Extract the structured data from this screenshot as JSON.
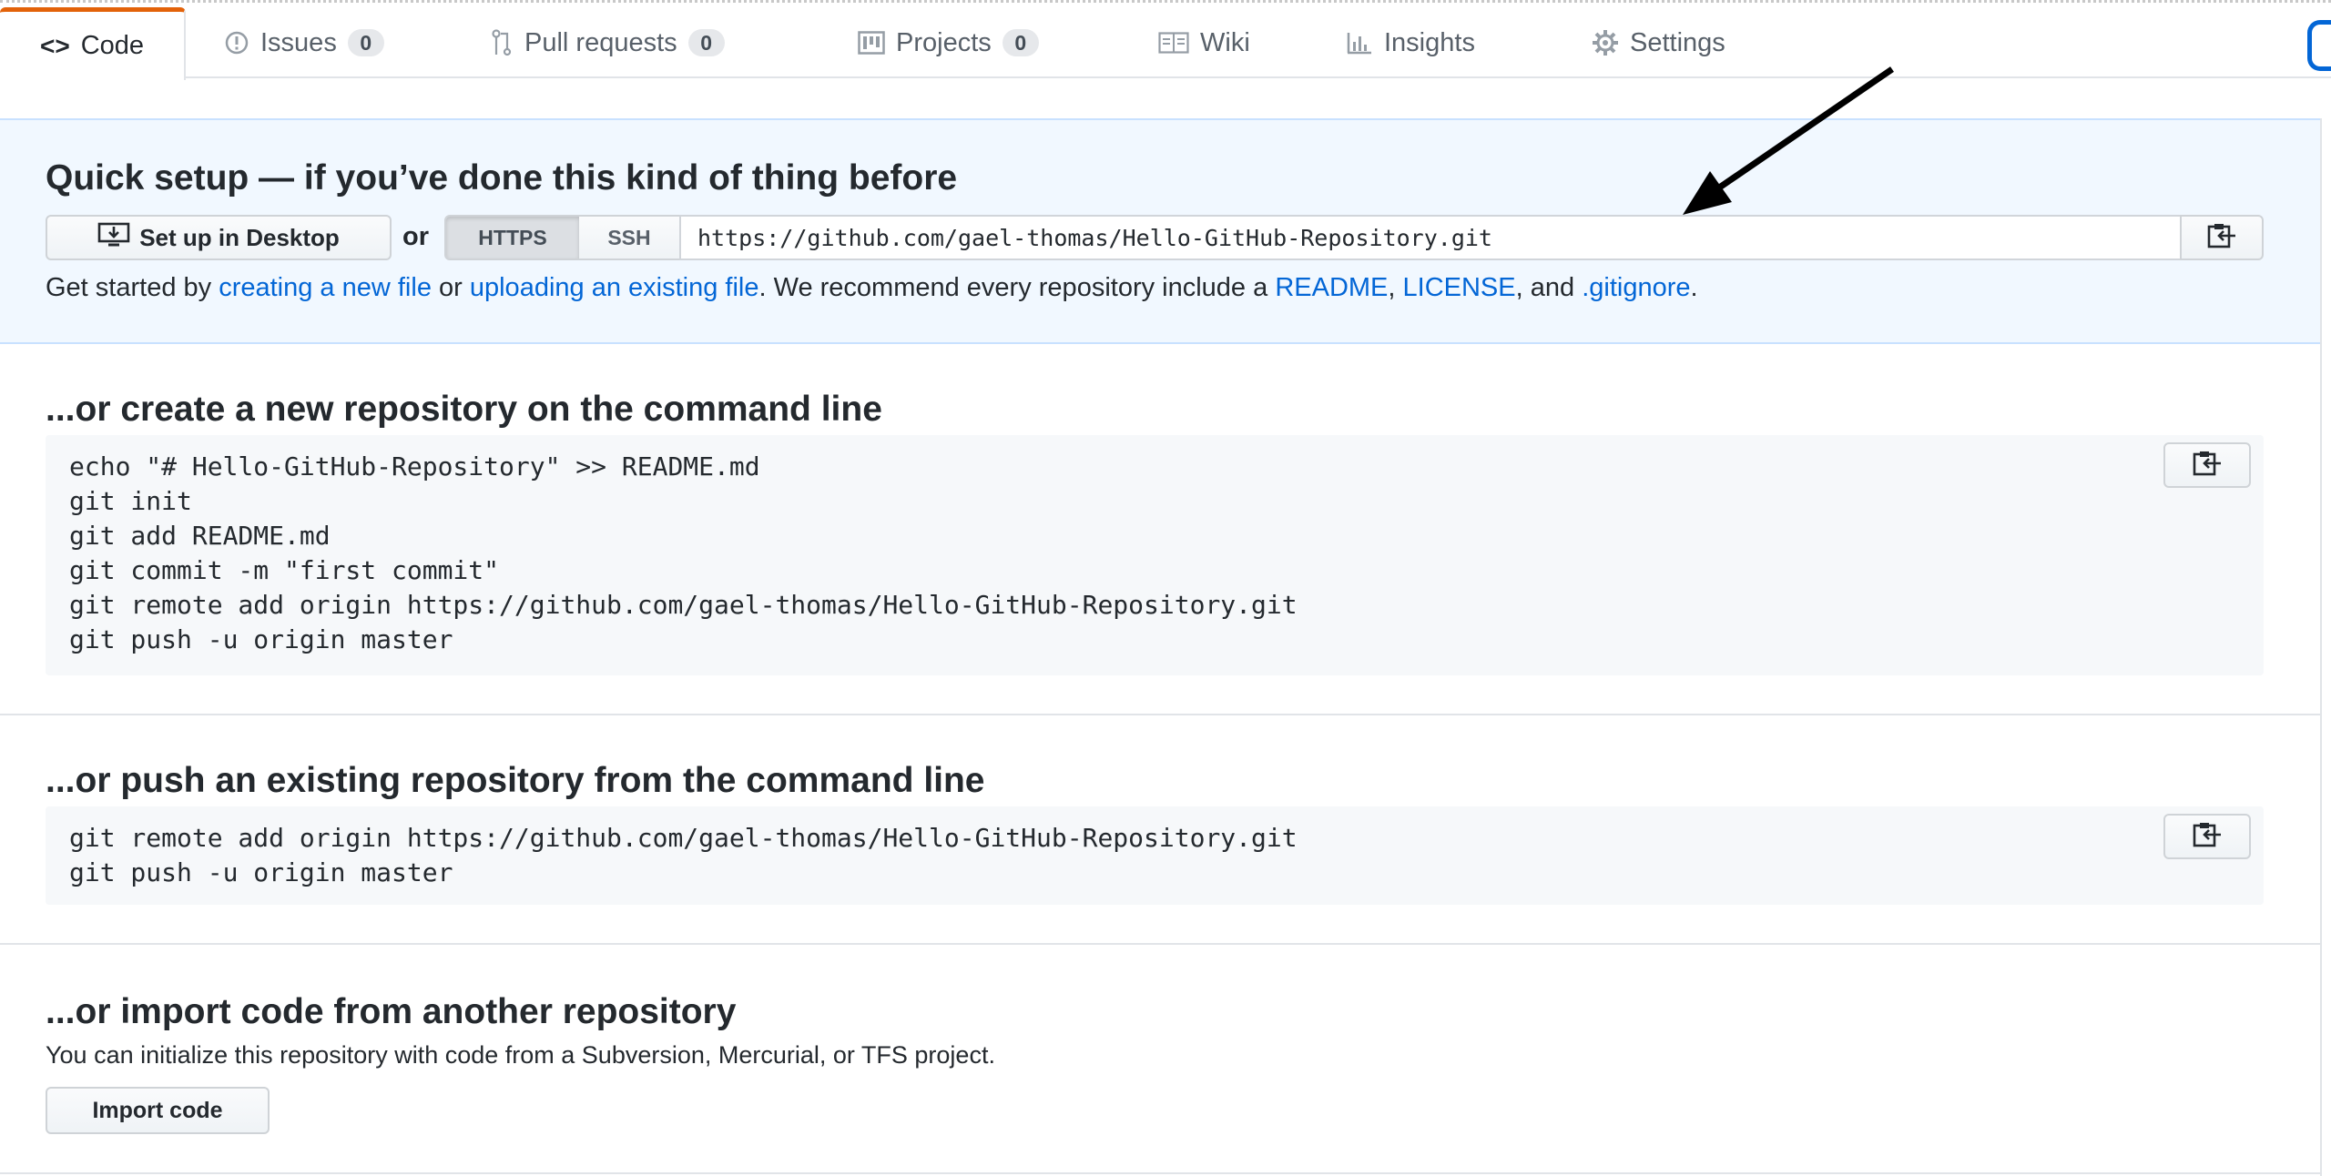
{
  "tabs": [
    {
      "label": "Code",
      "icon": "code-icon",
      "selected": true
    },
    {
      "label": "Issues",
      "icon": "issue-icon",
      "count": "0"
    },
    {
      "label": "Pull requests",
      "icon": "pull-request-icon",
      "count": "0"
    },
    {
      "label": "Projects",
      "icon": "project-icon",
      "count": "0"
    },
    {
      "label": "Wiki",
      "icon": "book-icon"
    },
    {
      "label": "Insights",
      "icon": "graph-icon"
    },
    {
      "label": "Settings",
      "icon": "gear-icon"
    }
  ],
  "quick_setup": {
    "title": "Quick setup — if you’ve done this kind of thing before",
    "desktop_button": "Set up in Desktop",
    "or": "or",
    "https_label": "HTTPS",
    "ssh_label": "SSH",
    "clone_url": "https://github.com/gael-thomas/Hello-GitHub-Repository.git",
    "desc_prefix": "Get started by ",
    "link_new_file": "creating a new file",
    "desc_or": " or ",
    "link_upload": "uploading an existing file",
    "desc_mid": ". We recommend every repository include a ",
    "link_readme": "README",
    "comma1": ", ",
    "link_license": "LICENSE",
    "desc_and": ", and ",
    "link_gitignore": ".gitignore",
    "desc_end": "."
  },
  "create_section": {
    "title": "...or create a new repository on the command line",
    "lines": [
      "echo \"# Hello-GitHub-Repository\" >> README.md",
      "git init",
      "git add README.md",
      "git commit -m \"first commit\"",
      "git remote add origin https://github.com/gael-thomas/Hello-GitHub-Repository.git",
      "git push -u origin master"
    ]
  },
  "push_section": {
    "title": "...or push an existing repository from the command line",
    "lines": [
      "git remote add origin https://github.com/gael-thomas/Hello-GitHub-Repository.git",
      "git push -u origin master"
    ]
  },
  "import_section": {
    "title": "...or import code from another repository",
    "description": "You can initialize this repository with code from a Subversion, Mercurial, or TFS project.",
    "button": "Import code"
  },
  "colors": {
    "accent_tab": "#e36209",
    "link": "#0366d6",
    "quick_bg": "#f1f8ff",
    "code_bg": "#f6f8fa"
  }
}
